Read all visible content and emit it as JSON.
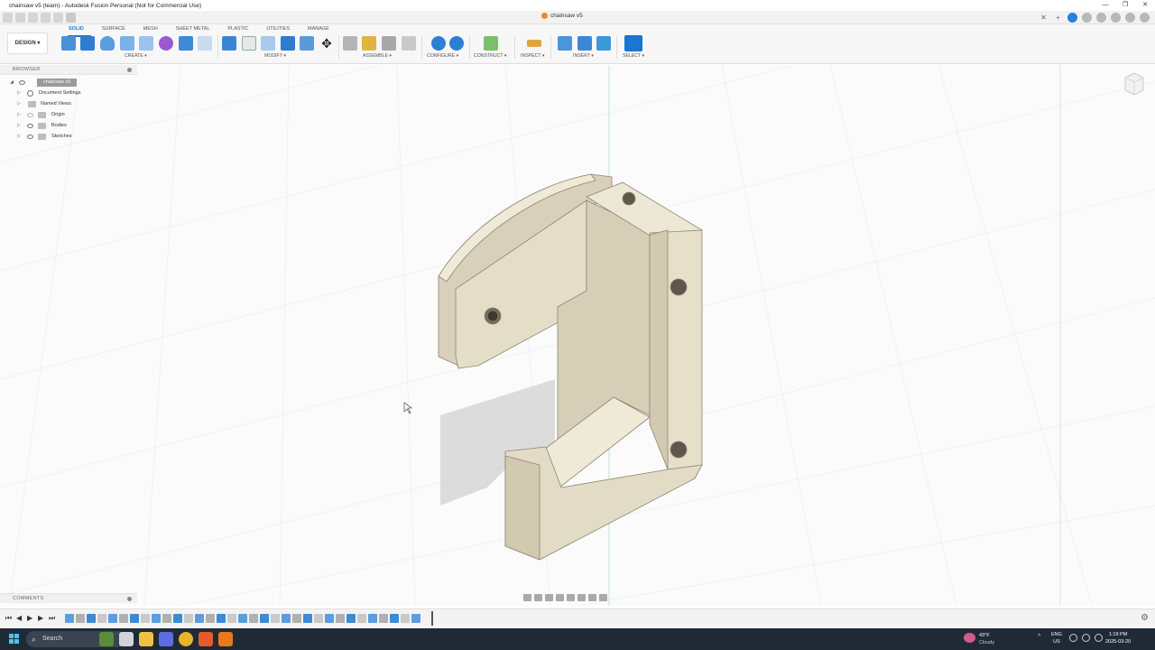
{
  "window": {
    "title": "chainsaw v5 (team) - Autodesk Fusion Personal (Not for Commercial Use)",
    "minimize": "—",
    "maximize": "❐",
    "close": "✕"
  },
  "document_tab": {
    "name": "chainsaw v5",
    "close": "✕"
  },
  "toolbar": {
    "workspace": "DESIGN ▾",
    "tabs": [
      "SOLID",
      "SURFACE",
      "MESH",
      "SHEET METAL",
      "PLASTIC",
      "UTILITIES",
      "MANAGE"
    ],
    "active_tab": "SOLID",
    "groups": {
      "create": "CREATE ▾",
      "modify": "MODIFY ▾",
      "assemble": "ASSEMBLE ▾",
      "configure": "CONFIGURE ▾",
      "construct": "CONSTRUCT ▾",
      "inspect": "INSPECT ▾",
      "insert": "INSERT ▾",
      "select": "SELECT ▾"
    }
  },
  "browser": {
    "header": "BROWSER",
    "root": "chainsaw v5",
    "items": [
      "Document Settings",
      "Named Views",
      "Origin",
      "Bodies",
      "Sketches"
    ]
  },
  "comments": {
    "header": "COMMENTS"
  },
  "timeline": {
    "controls": [
      "⏮",
      "◀",
      "▶",
      "▶",
      "⏭"
    ]
  },
  "taskbar": {
    "search_placeholder": "Search",
    "weather_temp": "43°F",
    "weather_desc": "Cloudy",
    "lang": "ENG",
    "region": "US",
    "time": "1:19 PM",
    "date": "2025-03-20"
  },
  "colors": {
    "accent": "#1b76d2",
    "part_fill": "#e2dbc6",
    "part_shade": "#cfc6ae",
    "part_edge": "#8f8670"
  }
}
